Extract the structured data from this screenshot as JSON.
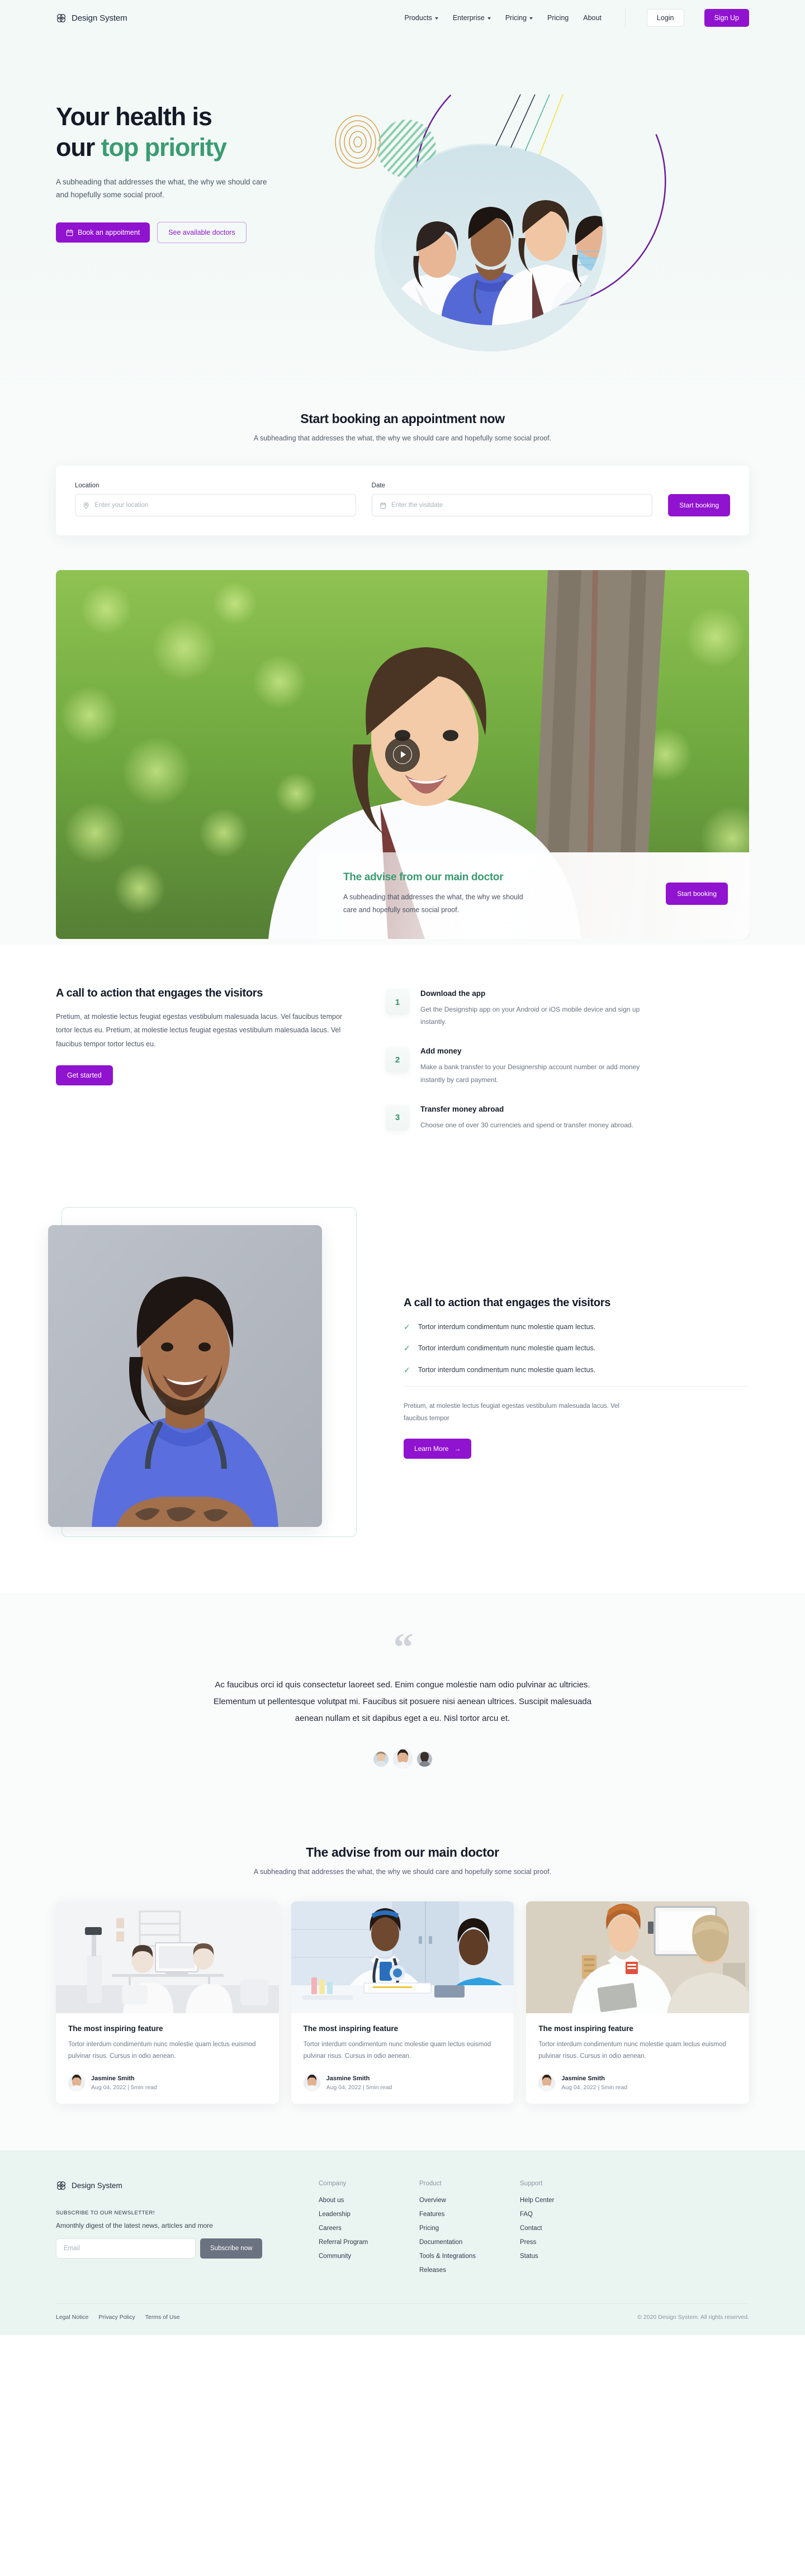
{
  "header": {
    "brand": "Design System",
    "nav": [
      {
        "label": "Products",
        "caret": true
      },
      {
        "label": "Enterprise",
        "caret": true
      },
      {
        "label": "Pricing",
        "caret": true
      },
      {
        "label": "Pricing",
        "caret": false
      },
      {
        "label": "About",
        "caret": false
      }
    ],
    "login_label": "Login",
    "signup_label": "Sign Up"
  },
  "hero": {
    "title_line1": "Your health is",
    "title_line2_plain": "our ",
    "title_line2_accent": "top priority",
    "subtitle": "A subheading that addresses the what, the why we should care and hopefully some social proof.",
    "primary_btn": "Book an appoitment",
    "outline_btn": "See available doctors"
  },
  "booking": {
    "title": "Start booking an appointment now",
    "subtitle": "A subheading that addresses the what, the why we should care and hopefully some social proof.",
    "location_label": "Location",
    "location_placeholder": "Enter your location",
    "date_label": "Date",
    "date_placeholder": "Enter the visitdate",
    "submit_label": "Start booking"
  },
  "video": {
    "overlay_title": "The advise from our main doctor",
    "overlay_sub": "A subheading that addresses the what, the why we should care and hopefully some social proof.",
    "overlay_btn": "Start booking"
  },
  "cta_steps": {
    "heading": "A call to action that engages the visitors",
    "paragraph": "Pretium, at molestie lectus feugiat egestas vestibulum malesuada lacus. Vel faucibus tempor tortor lectus eu. Pretium, at molestie lectus feugiat egestas vestibulum malesuada lacus. Vel faucibus tempor tortor lectus eu.",
    "button": "Get started",
    "steps": [
      {
        "num": "1",
        "title": "Download the app",
        "desc": "Get the Designship app on your Android or iOS mobile device and sign up instantly."
      },
      {
        "num": "2",
        "title": "Add money",
        "desc": "Make a bank transfer to your Designership account number or add money instantly by card payment."
      },
      {
        "num": "3",
        "title": "Transfer money abroad",
        "desc": "Choose one of over 30 currencies and spend or transfer money abroad."
      }
    ]
  },
  "feature": {
    "heading": "A call to action that engages the visitors",
    "checks": [
      "Tortor interdum condimentum nunc molestie quam lectus.",
      "Tortor interdum condimentum nunc molestie quam lectus.",
      "Tortor interdum condimentum nunc molestie quam lectus."
    ],
    "paragraph": "Pretium, at molestie lectus feugiat egestas vestibulum malesuada lacus. Vel faucibus tempor",
    "button": "Learn More",
    "button_arrow": "→"
  },
  "testimonial": {
    "quote_mark": "“",
    "text": "Ac faucibus orci id quis consectetur laoreet sed. Enim congue molestie nam odio pulvinar ac ultricies. Elementum ut pellentesque volutpat mi. Faucibus sit posuere nisi aenean ultrices. Suscipit malesuada aenean nullam et sit dapibus eget a eu. Nisl tortor arcu et."
  },
  "blog": {
    "title": "The advise from our main doctor",
    "subtitle": "A subheading that addresses the what, the why we should care and hopefully some social proof.",
    "cards": [
      {
        "title": "The most inspiring feature",
        "desc": "Tortor interdum condimentum nunc molestie quam lectus euismod pulvinar risus. Cursus in odio aenean.",
        "author": "Jasmine Smith",
        "date": "Aug 04, 2022 | 5min read"
      },
      {
        "title": "The most inspiring feature",
        "desc": "Tortor interdum condimentum nunc molestie quam lectus euismod pulvinar risus. Cursus in odio aenean.",
        "author": "Jasmine Smith",
        "date": "Aug 04, 2022 | 5min read"
      },
      {
        "title": "The most inspiring feature",
        "desc": "Tortor interdum condimentum nunc molestie quam lectus euismod pulvinar risus. Cursus in odio aenean.",
        "author": "Jasmine Smith",
        "date": "Aug 04, 2022 | 5min read"
      }
    ]
  },
  "footer": {
    "brand": "Design System",
    "newsletter_label": "SUBSCRIBE TO OUR NEWSLETTER!",
    "newsletter_sub": "Amonthly digest of the latest news, articles and more",
    "email_placeholder": "Email",
    "subscribe_label": "Subscribe now",
    "columns": [
      {
        "heading": "Company",
        "links": [
          "About us",
          "Leadership",
          "Careers",
          "Referral Program",
          "Community"
        ]
      },
      {
        "heading": "Product",
        "links": [
          "Overview",
          "Features",
          "Pricing",
          "Documentation",
          "Tools & Integrations",
          "Releases"
        ]
      },
      {
        "heading": "Support",
        "links": [
          "Help Center",
          "FAQ",
          "Contact",
          "Press",
          "Status"
        ]
      }
    ],
    "legal": [
      "Legal Notice",
      "Privacy Policy",
      "Terms of Use"
    ],
    "copyright": "© 2020 Design System. All rights reserved."
  },
  "colors": {
    "purple": "#9013cf",
    "green": "#3a9c72",
    "dark": "#141a27",
    "footer_bg": "#eaf4f1",
    "hero_bg": "#f3f9f7"
  }
}
